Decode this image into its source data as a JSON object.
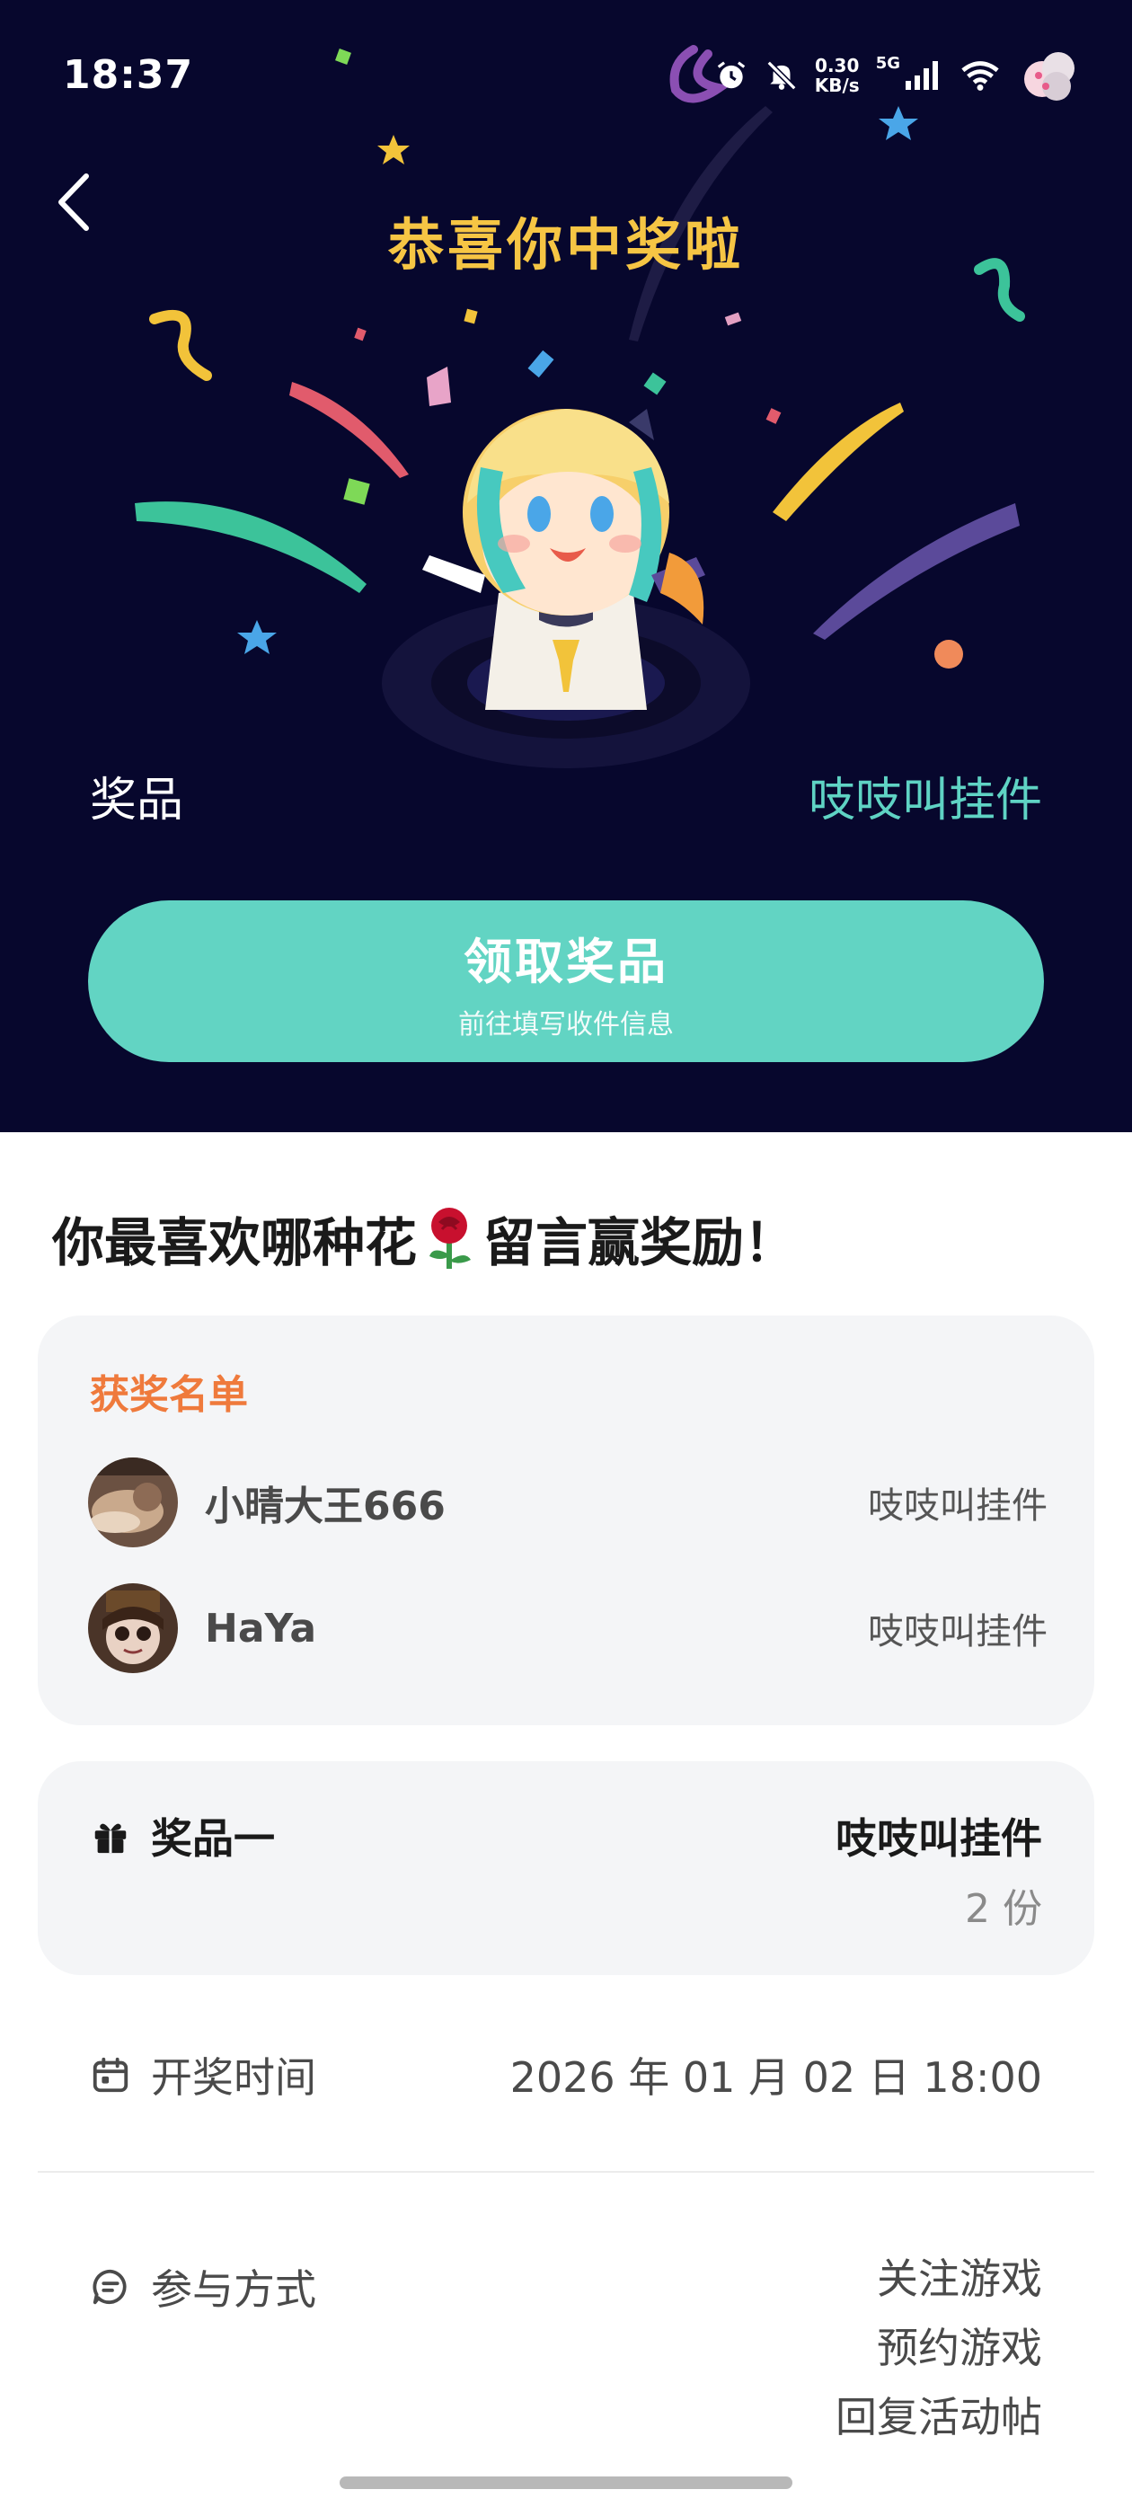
{
  "status_bar": {
    "time": "18:37",
    "net_speed_value": "0.30",
    "net_speed_unit": "KB/s",
    "network_type": "5G",
    "icons": [
      "app-logo-icon",
      "alarm-icon",
      "mute-icon",
      "signal-icon",
      "wifi-icon",
      "avatar-icon"
    ]
  },
  "hero": {
    "title": "恭喜你中奖啦",
    "prize_label": "奖品",
    "prize_value": "吱吱叫挂件",
    "claim_button": {
      "label": "领取奖品",
      "sub_label": "前往填写收件信息"
    }
  },
  "post": {
    "title_before": "你最喜欢哪种花",
    "title_emoji": "rose-icon",
    "title_after": "留言赢奖励！"
  },
  "winners": {
    "heading": "获奖名单",
    "list": [
      {
        "name": "小晴大王666",
        "prize": "吱吱叫挂件"
      },
      {
        "name": "HaYa",
        "prize": "吱吱叫挂件"
      }
    ]
  },
  "prize_info": {
    "label": "奖品一",
    "name": "吱吱叫挂件",
    "quantity": "2 份"
  },
  "draw_time": {
    "label": "开奖时间",
    "value": "2026 年 01 月 02 日 18:00"
  },
  "participation": {
    "label": "参与方式",
    "methods": [
      "关注游戏",
      "预约游戏",
      "回复活动帖"
    ]
  },
  "colors": {
    "hero_bg": "#07072d",
    "title_yellow": "#f6c544",
    "accent_teal": "#62d4c3",
    "winners_orange": "#ef7a3c",
    "card_bg": "#f4f5f7"
  }
}
